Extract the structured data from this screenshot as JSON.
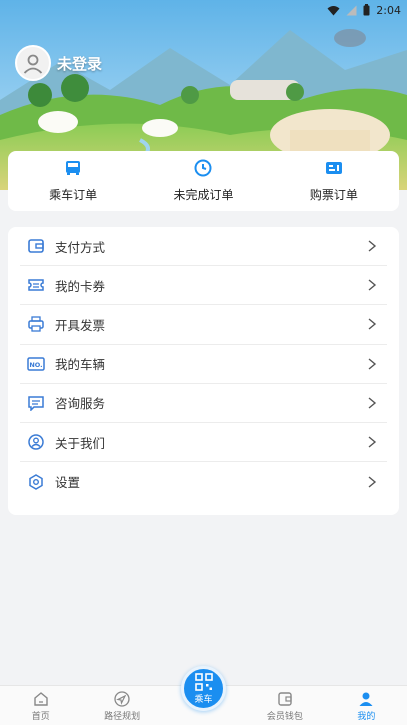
{
  "status_bar": {
    "time": "2:04"
  },
  "user": {
    "name": "未登录"
  },
  "orders": [
    {
      "label": "乘车订单",
      "icon": "bus-icon"
    },
    {
      "label": "未完成订单",
      "icon": "clock-icon"
    },
    {
      "label": "购票订单",
      "icon": "ticket-icon"
    }
  ],
  "menu": [
    {
      "label": "支付方式",
      "icon": "wallet-icon"
    },
    {
      "label": "我的卡券",
      "icon": "coupon-icon"
    },
    {
      "label": "开具发票",
      "icon": "printer-icon"
    },
    {
      "label": "我的车辆",
      "icon": "license-plate-icon"
    },
    {
      "label": "咨询服务",
      "icon": "chat-icon"
    },
    {
      "label": "关于我们",
      "icon": "person-icon"
    },
    {
      "label": "设置",
      "icon": "settings-icon"
    }
  ],
  "tabbar": {
    "tabs": [
      {
        "label": "首页",
        "icon": "home-icon"
      },
      {
        "label": "路径规划",
        "icon": "navigation-icon"
      },
      {
        "label": "会员钱包",
        "icon": "wallet-icon"
      },
      {
        "label": "我的",
        "icon": "person-icon"
      }
    ],
    "center": {
      "label": "乘车",
      "icon": "qr-code-icon"
    },
    "active_index": 3
  },
  "colors": {
    "accent": "#1b8ef0",
    "background": "#f2f3f5"
  }
}
